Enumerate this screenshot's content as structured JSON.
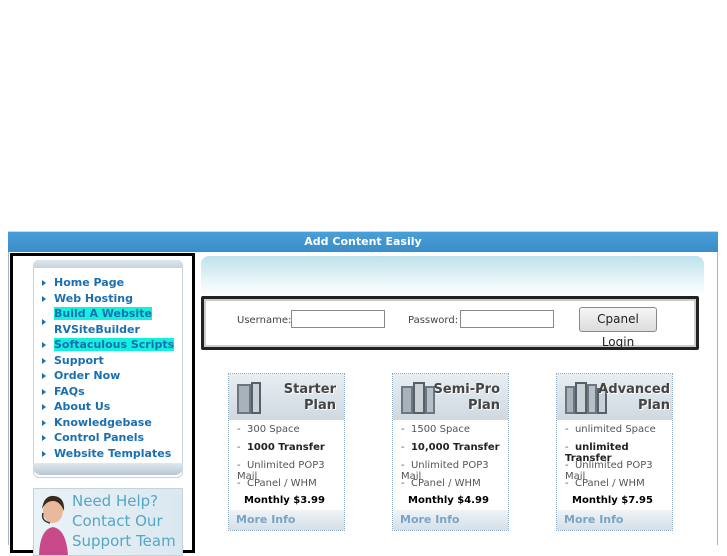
{
  "header": {
    "bar_label": "Add Content Easily"
  },
  "nav": {
    "items": [
      {
        "label": "Home Page"
      },
      {
        "label": "Web Hosting"
      },
      {
        "label": "Build A Website",
        "label2": "RVSiteBuilder"
      },
      {
        "label": "Softaculous Scripts"
      },
      {
        "label": "Support"
      },
      {
        "label": "Order Now"
      },
      {
        "label": "FAQs"
      },
      {
        "label": "About Us"
      },
      {
        "label": "Knowledgebase"
      },
      {
        "label": "Control Panels"
      },
      {
        "label": "Website Templates"
      }
    ]
  },
  "help": {
    "line1": "Need Help?",
    "line2": "Contact Our",
    "line3": "Support Team"
  },
  "login": {
    "username_label": "Username:",
    "password_label": "Password:",
    "button": "Cpanel Login",
    "username_value": "",
    "password_value": ""
  },
  "plans": [
    {
      "name1": "Starter",
      "name2": "Plan",
      "space": "300 Space",
      "transfer": "1000 Transfer",
      "mail": "Unlimited POP3 Mail",
      "panel": "CPanel / WHM",
      "price": "Monthly $3.99",
      "more": "More Info"
    },
    {
      "name1": "Semi-Pro",
      "name2": "Plan",
      "space": "1500 Space",
      "transfer": "10,000 Transfer",
      "mail": "Unlimited POP3 Mail",
      "panel": "CPanel / WHM",
      "price": "Monthly $4.99",
      "more": "More Info"
    },
    {
      "name1": "Advanced",
      "name2": "Plan",
      "space": "unlimited Space",
      "transfer": "unlimited Transfer",
      "mail": "Unlimited POP3 Mail",
      "panel": "CPanel / WHM",
      "price": "Monthly $7.95",
      "more": "More Info"
    }
  ],
  "colors": {
    "accent": "#3a8dc8",
    "nav_link": "#1a6fb0",
    "highlight": "#14f0e0",
    "help_text": "#56a6c6",
    "more_info": "#7aa3c8"
  },
  "icons": {
    "nav_bullet": "triangle-right-icon",
    "plan_image": "server-rack-icon",
    "help_image": "support-agent-icon"
  }
}
